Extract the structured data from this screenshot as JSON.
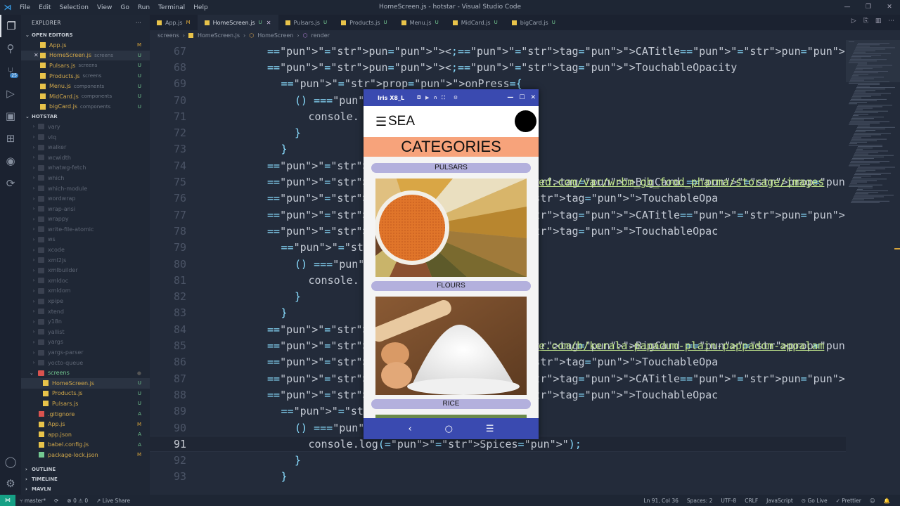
{
  "titlebar": {
    "menu": [
      "File",
      "Edit",
      "Selection",
      "View",
      "Go",
      "Run",
      "Terminal",
      "Help"
    ],
    "title": "HomeScreen.js - hotstar - Visual Studio Code"
  },
  "activity_badge": "25",
  "explorer": {
    "header": "EXPLORER",
    "open_editors_label": "OPEN EDITORS",
    "open_editors": [
      {
        "name": "App.js",
        "dir": "",
        "status": "M"
      },
      {
        "name": "HomeScreen.js",
        "dir": "screens",
        "status": "U"
      },
      {
        "name": "Pulsars.js",
        "dir": "screens",
        "status": "U"
      },
      {
        "name": "Products.js",
        "dir": "screens",
        "status": "U"
      },
      {
        "name": "Menu.js",
        "dir": "components",
        "status": "U"
      },
      {
        "name": "MidCard.js",
        "dir": "components",
        "status": "U"
      },
      {
        "name": "bigCard.js",
        "dir": "components",
        "status": "U"
      }
    ],
    "project_label": "HOTSTAR",
    "folders": [
      "vary",
      "vlq",
      "walker",
      "wcwidth",
      "whatwg-fetch",
      "which",
      "which-module",
      "wordwrap",
      "wrap-ansi",
      "wrappy",
      "write-file-atomic",
      "ws",
      "xcode",
      "xml2js",
      "xmlbuilder",
      "xmldoc",
      "xmldom",
      "xpipe",
      "xtend",
      "y18n",
      "yallist",
      "yargs",
      "yargs-parser",
      "yocto-queue"
    ],
    "screens_folder": "screens",
    "screens_files": [
      {
        "name": "HomeScreen.js",
        "status": "U"
      },
      {
        "name": "Products.js",
        "status": "U"
      },
      {
        "name": "Pulsars.js",
        "status": "U"
      }
    ],
    "root_files": [
      {
        "name": ".gitignore",
        "status": "A"
      },
      {
        "name": "App.js",
        "status": "M"
      },
      {
        "name": "app.json",
        "status": "A"
      },
      {
        "name": "babel.config.js",
        "status": "A"
      },
      {
        "name": "package-lock.json",
        "status": "M"
      }
    ],
    "outline_label": "OUTLINE",
    "timeline_label": "TIMELINE",
    "mavln_label": "MAVLN"
  },
  "tabs": [
    {
      "name": "App.js",
      "status": "M"
    },
    {
      "name": "HomeScreen.js",
      "status": "U",
      "active": true
    },
    {
      "name": "Pulsars.js",
      "status": "U"
    },
    {
      "name": "Products.js",
      "status": "U"
    },
    {
      "name": "Menu.js",
      "status": "U"
    },
    {
      "name": "MidCard.js",
      "status": "U"
    },
    {
      "name": "bigCard.js",
      "status": "U"
    }
  ],
  "breadcrumb": [
    "screens",
    "HomeScreen.js",
    "HomeScreen",
    "render"
  ],
  "code": {
    "current_line": "91",
    "lines": [
      {
        "n": "67",
        "text": "<CATitle>RICE</CATitle>"
      },
      {
        "n": "68",
        "text": "<TouchableOpacity"
      },
      {
        "n": "69",
        "text": "onPress={"
      },
      {
        "n": "70",
        "text": "() =>{"
      },
      {
        "n": "71",
        "text": "console."
      },
      {
        "n": "72",
        "text": "}"
      },
      {
        "n": "73",
        "text": "}"
      },
      {
        "n": "74",
        "text": ">"
      },
      {
        "n": "75",
        "text": "<BigCard Image"
      },
      {
        "n": "76",
        "text": "</TouchableOpa"
      },
      {
        "n": "77",
        "text": "<CATitle>OTHER"
      },
      {
        "n": "78",
        "text": "<TouchableOpac"
      },
      {
        "n": "79",
        "text": "onPress={"
      },
      {
        "n": "80",
        "text": "() =>{"
      },
      {
        "n": "81",
        "text": "console."
      },
      {
        "n": "82",
        "text": "}"
      },
      {
        "n": "83",
        "text": "}"
      },
      {
        "n": "84",
        "text": ">"
      },
      {
        "n": "85",
        "text": "<BigCard Image"
      },
      {
        "n": "86",
        "text": "</TouchableOpa"
      },
      {
        "n": "87",
        "text": "<CATitle>SPICE"
      },
      {
        "n": "88",
        "text": "<TouchableOpac"
      },
      {
        "n": "89",
        "text": "onPress={"
      },
      {
        "n": "90",
        "text": "() =>{"
      },
      {
        "n": "91",
        "text": "console.log(\"Spices\");"
      },
      {
        "n": "92",
        "text": "}"
      },
      {
        "n": "93",
        "text": "}"
      }
    ],
    "url_75": "ed.com/var/wrbm_gb_food_pharma/storage/images",
    "url_85": "e.com/b/kerala-papadum-plain-pappadom-appalam"
  },
  "statusbar": {
    "branch": "master*",
    "errors": "0",
    "warnings": "0",
    "liveshare": "Live Share",
    "position": "Ln 91, Col 36",
    "spaces": "Spaces: 2",
    "encoding": "UTF-8",
    "eol": "CRLF",
    "language": "JavaScript",
    "golive": "Go Live",
    "prettier": "Prettier"
  },
  "emulator": {
    "title": "Iris X8_L",
    "app_name": "SEA",
    "header": "CATEGORIES",
    "categories": [
      "PULSARS",
      "FLOURS",
      "RICE"
    ],
    "colors": {
      "header_bg": "#f7a37b",
      "pill": "#b3b0dd",
      "frame": "#3a4ab0"
    }
  }
}
